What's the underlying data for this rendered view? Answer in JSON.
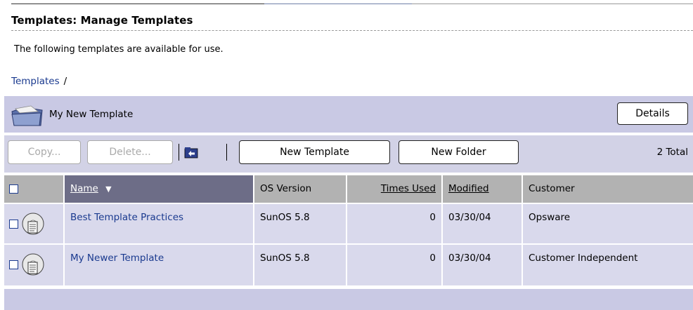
{
  "page": {
    "title": "Templates: Manage Templates",
    "description": "The following templates are available for use."
  },
  "breadcrumb": {
    "root_label": "Templates",
    "separator": "/"
  },
  "folder_bar": {
    "folder_name": "My New Template",
    "details_label": "Details",
    "icon": "folder-open-icon"
  },
  "toolbar": {
    "copy_label": "Copy...",
    "delete_label": "Delete...",
    "up_folder_icon": "up-folder-icon",
    "new_template_label": "New Template",
    "new_folder_label": "New Folder",
    "total_label": "2 Total"
  },
  "table": {
    "columns": {
      "name": "Name",
      "os_version": "OS Version",
      "times_used": "Times Used",
      "modified": "Modified",
      "customer": "Customer"
    },
    "sort_indicator": "▼",
    "rows": [
      {
        "name": "Best Template Practices",
        "os_version": "SunOS 5.8",
        "times_used": "0",
        "modified": "03/30/04",
        "customer": "Opsware",
        "icon": "template-disc-icon"
      },
      {
        "name": "My Newer Template",
        "os_version": "SunOS 5.8",
        "times_used": "0",
        "modified": "03/30/04",
        "customer": "Customer Independent",
        "icon": "template-disc-icon"
      }
    ]
  },
  "colors": {
    "link": "#1a3a8f",
    "folder_bar_bg": "#c9c9e4",
    "row_bg": "#d9d9ec",
    "header_bg": "#b2b2b2",
    "sorted_header_bg": "#6d6d87"
  }
}
